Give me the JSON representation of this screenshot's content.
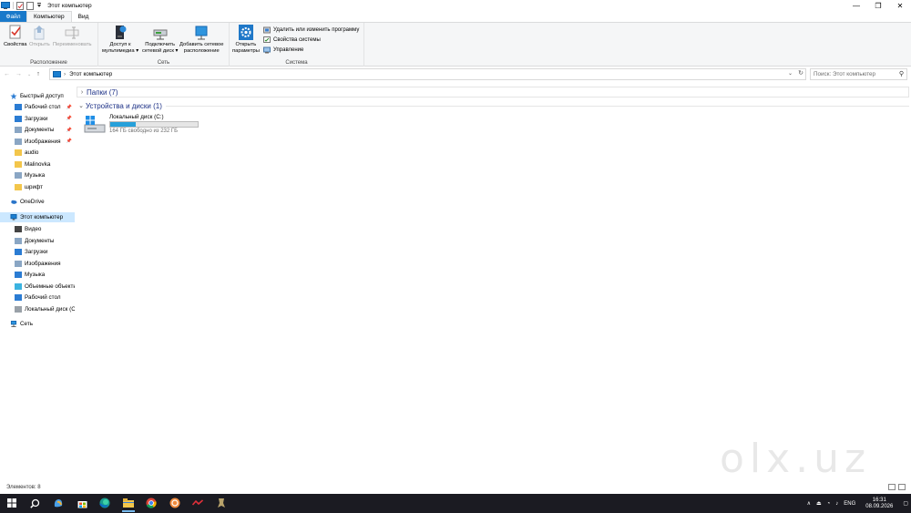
{
  "window": {
    "title": "Этот компьютер",
    "controls": [
      "—",
      "❐",
      "✕"
    ]
  },
  "tabs": [
    {
      "label": "Файл"
    },
    {
      "label": "Компьютер"
    },
    {
      "label": "Вид"
    }
  ],
  "ribbon": {
    "groups": {
      "location": {
        "label": "Расположение",
        "properties": "Свойства",
        "open": "Открыть",
        "rename": "Переименовать"
      },
      "network": {
        "label": "Сеть",
        "media_access_1": "Доступ к",
        "media_access_2": "мультимедиа ▾",
        "map_drive_1": "Подключить",
        "map_drive_2": "сетевой диск ▾",
        "add_location_1": "Добавить сетевое",
        "add_location_2": "расположение"
      },
      "system": {
        "label": "Система",
        "open_settings_1": "Открыть",
        "open_settings_2": "параметры",
        "uninstall": "Удалить или изменить программу",
        "system_props": "Свойства системы",
        "manage": "Управление"
      }
    }
  },
  "address": {
    "path": "Этот компьютер",
    "search_placeholder": "Поиск: Этот компьютер"
  },
  "nav": {
    "quick_access": "Быстрый доступ",
    "quick_items": [
      {
        "label": "Рабочий стол",
        "pinned": true
      },
      {
        "label": "Загрузки",
        "pinned": true
      },
      {
        "label": "Документы",
        "pinned": true
      },
      {
        "label": "Изображения",
        "pinned": true
      },
      {
        "label": "audio",
        "pinned": false
      },
      {
        "label": "Malinovka",
        "pinned": false
      },
      {
        "label": "Музыка",
        "pinned": false
      },
      {
        "label": "шрифт",
        "pinned": false
      }
    ],
    "onedrive": "OneDrive",
    "this_pc": "Этот компьютер",
    "pc_items": [
      {
        "label": "Видео"
      },
      {
        "label": "Документы"
      },
      {
        "label": "Загрузки"
      },
      {
        "label": "Изображения"
      },
      {
        "label": "Музыка"
      },
      {
        "label": "Объемные объекты"
      },
      {
        "label": "Рабочий стол"
      },
      {
        "label": "Локальный диск (C:)"
      }
    ],
    "network": "Сеть"
  },
  "content": {
    "folders_section": "Папки (7)",
    "drives_section": "Устройства и диски (1)",
    "drive": {
      "name": "Локальный диск (C:)",
      "free_text": "164 ГБ свободно из 232 ГБ",
      "used_fraction": 0.293
    }
  },
  "status": {
    "items": "Элементов: 8"
  },
  "watermark": "olx.uz",
  "taskbar": {
    "lang": "ENG",
    "time": "16:31",
    "date": "08.09.2026"
  },
  "colors": {
    "file_tab": "#1979ca",
    "selection": "#cce8ff",
    "drive_bar": "#26a0da",
    "taskbar": "#1b1b22"
  }
}
